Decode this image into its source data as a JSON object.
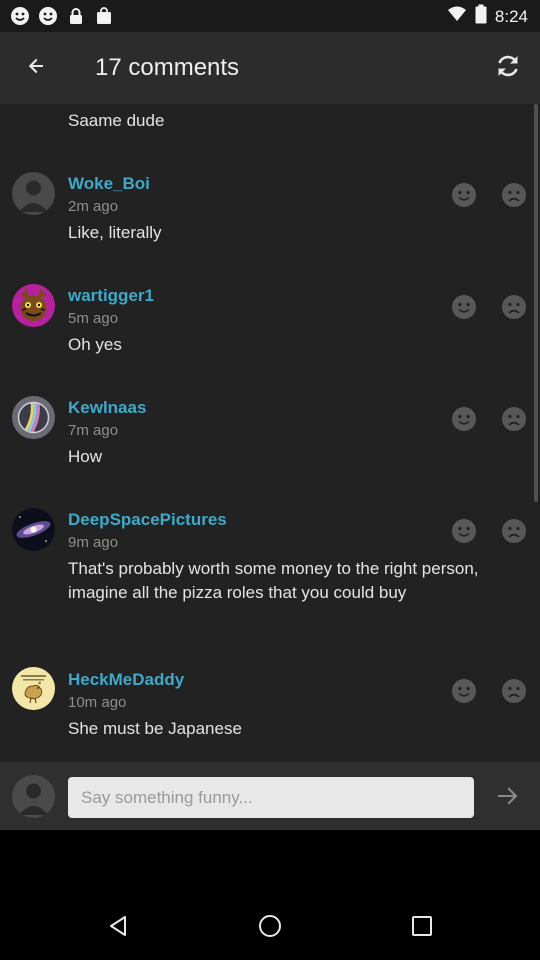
{
  "status_bar": {
    "time": "8:24",
    "icons": [
      "smiley-icon",
      "smiley-icon",
      "lock-icon",
      "shopping-bag-icon",
      "wifi-icon",
      "battery-icon"
    ]
  },
  "toolbar": {
    "title": "17 comments",
    "back_icon": "arrow-left-icon",
    "refresh_icon": "refresh-icon"
  },
  "partial_comment": {
    "text": "Saame dude"
  },
  "comments": [
    {
      "username": "Woke_Boi",
      "time": "2m ago",
      "text": "Like, literally",
      "avatar": "default-user-avatar"
    },
    {
      "username": "wartigger1",
      "time": "5m ago",
      "text": "Oh yes",
      "avatar": "cartoon-tiger-avatar"
    },
    {
      "username": "Kewlnaas",
      "time": "7m ago",
      "text": "How",
      "avatar": "rainbow-sphere-avatar"
    },
    {
      "username": "DeepSpacePictures",
      "time": "9m ago",
      "text": "That's probably worth some money to the right person, imagine all the pizza roles that you could buy",
      "avatar": "galaxy-avatar"
    },
    {
      "username": "HeckMeDaddy",
      "time": "10m ago",
      "text": "She must be Japanese",
      "avatar": "chicken-sign-avatar",
      "avatar_lettering": "HITLER WAS RIGHT ABOUT CHICKEN"
    }
  ],
  "reactions": {
    "like_icon": "smile-face-icon",
    "dislike_icon": "sad-face-icon"
  },
  "input": {
    "placeholder": "Say something funny...",
    "value": "",
    "send_icon": "arrow-right-icon"
  },
  "nav_bar": {
    "icons": [
      "back-triangle-icon",
      "home-circle-icon",
      "recents-square-icon"
    ]
  },
  "colors": {
    "accent": "#3fa9ca",
    "toolbar": "#2c2c2c",
    "list_bg": "#222222",
    "input_bar": "#2f2f2f"
  }
}
